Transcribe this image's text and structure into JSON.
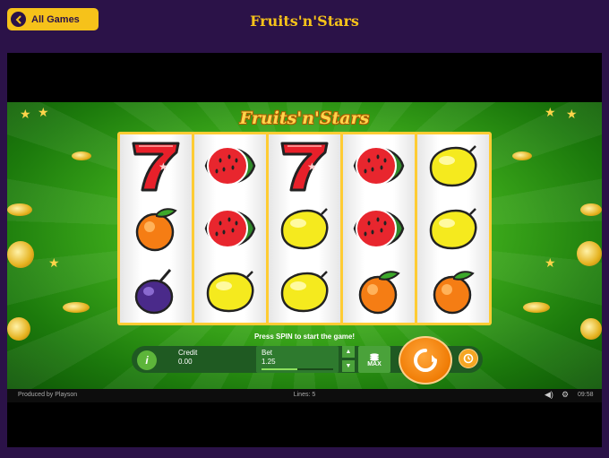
{
  "header": {
    "back_label": "All Games",
    "site_title": "Fruits'n'Stars"
  },
  "game": {
    "logo": "Fruits'n'Stars",
    "message": "Press SPIN to start the game!",
    "reels": [
      [
        "seven",
        "orange",
        "plum"
      ],
      [
        "watermelon",
        "watermelon",
        "lemon"
      ],
      [
        "seven",
        "lemon",
        "lemon"
      ],
      [
        "watermelon",
        "watermelon",
        "orange"
      ],
      [
        "lemon",
        "lemon",
        "orange"
      ]
    ],
    "credit_label": "Credit",
    "credit_value": "0.00",
    "bet_label": "Bet",
    "bet_value": "1.25",
    "bet_level_fraction": 0.5,
    "max_label": "MAX",
    "info_label": "i",
    "produced_by": "Produced by Playson",
    "lines": "Lines: 5",
    "clock": "09:58"
  },
  "colors": {
    "accent": "#f6c21a",
    "background": "#2b1248",
    "spin": "#f07c05"
  },
  "icons": [
    "arrow-left-icon",
    "spin-arrow-icon",
    "autoplay-icon",
    "sound-icon",
    "gear-icon",
    "coins-stack-icon"
  ]
}
